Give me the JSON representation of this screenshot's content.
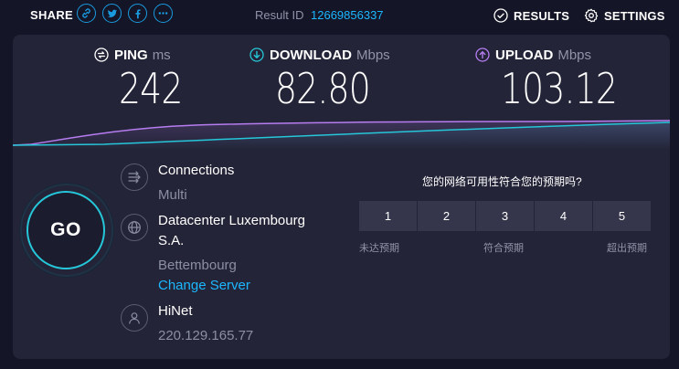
{
  "header": {
    "share_label": "SHARE",
    "share_icons": [
      "link-icon",
      "twitter-icon",
      "facebook-icon",
      "more-icon"
    ],
    "result_label": "Result ID",
    "result_id": "12669856337",
    "results_label": "RESULTS",
    "settings_label": "SETTINGS"
  },
  "metrics": {
    "ping": {
      "label": "PING",
      "unit": "ms",
      "value": "242",
      "color": "#ffffff"
    },
    "download": {
      "label": "DOWNLOAD",
      "unit": "Mbps",
      "value": "82.80",
      "color": "#25c7d9"
    },
    "upload": {
      "label": "UPLOAD",
      "unit": "Mbps",
      "value": "103.12",
      "color": "#b67cf0"
    }
  },
  "go_label": "GO",
  "connections": {
    "title": "Connections",
    "value": "Multi"
  },
  "server": {
    "name_line1": "Datacenter Luxembourg",
    "name_line2": "S.A.",
    "location": "Bettembourg",
    "change_label": "Change Server"
  },
  "provider": {
    "name": "HiNet",
    "ip": "220.129.165.77"
  },
  "survey": {
    "question": "您的网络可用性符合您的预期吗?",
    "options": [
      "1",
      "2",
      "3",
      "4",
      "5"
    ],
    "label_low": "未达预期",
    "label_mid": "符合预期",
    "label_high": "超出预期"
  },
  "colors": {
    "accent": "#1cb7ff",
    "download": "#25c7d9",
    "upload": "#b67cf0",
    "background": "#141526",
    "card": "#232437"
  }
}
